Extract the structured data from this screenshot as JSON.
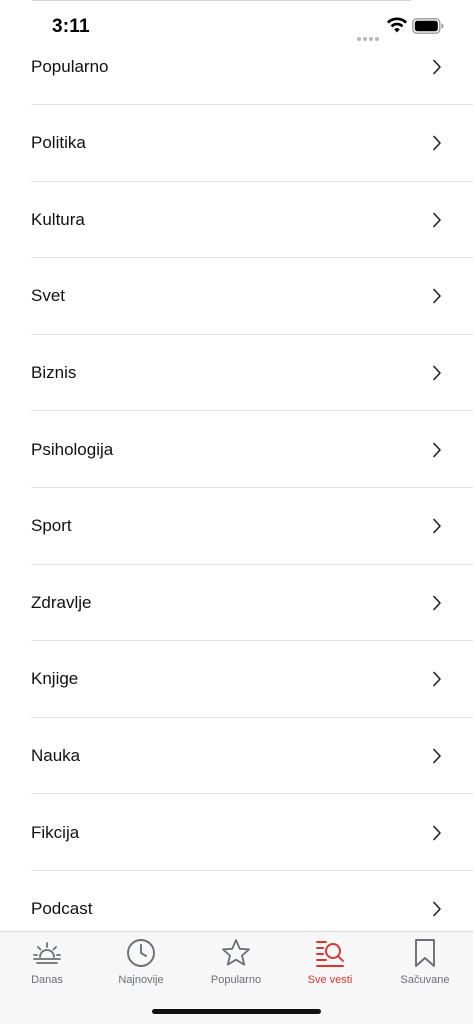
{
  "status_bar": {
    "time": "3:11"
  },
  "categories": [
    {
      "label": "Popularno"
    },
    {
      "label": "Politika"
    },
    {
      "label": "Kultura"
    },
    {
      "label": "Svet"
    },
    {
      "label": "Biznis"
    },
    {
      "label": "Psihologija"
    },
    {
      "label": "Sport"
    },
    {
      "label": "Zdravlje"
    },
    {
      "label": "Knjige"
    },
    {
      "label": "Nauka"
    },
    {
      "label": "Fikcija"
    },
    {
      "label": "Podcast"
    }
  ],
  "tab_bar": {
    "tabs": [
      {
        "label": "Danas",
        "icon": "sunrise-icon"
      },
      {
        "label": "Najnovije",
        "icon": "clock-icon"
      },
      {
        "label": "Popularno",
        "icon": "star-icon"
      },
      {
        "label": "Sve vesti",
        "icon": "list-search-icon",
        "active": true
      },
      {
        "label": "Sačuvane",
        "icon": "bookmark-icon"
      }
    ]
  },
  "colors": {
    "accent": "#e0332f",
    "tab_inactive": "#6a6f75",
    "divider": "#e3e3e3",
    "tab_bar_bg": "#f7f7f7"
  }
}
